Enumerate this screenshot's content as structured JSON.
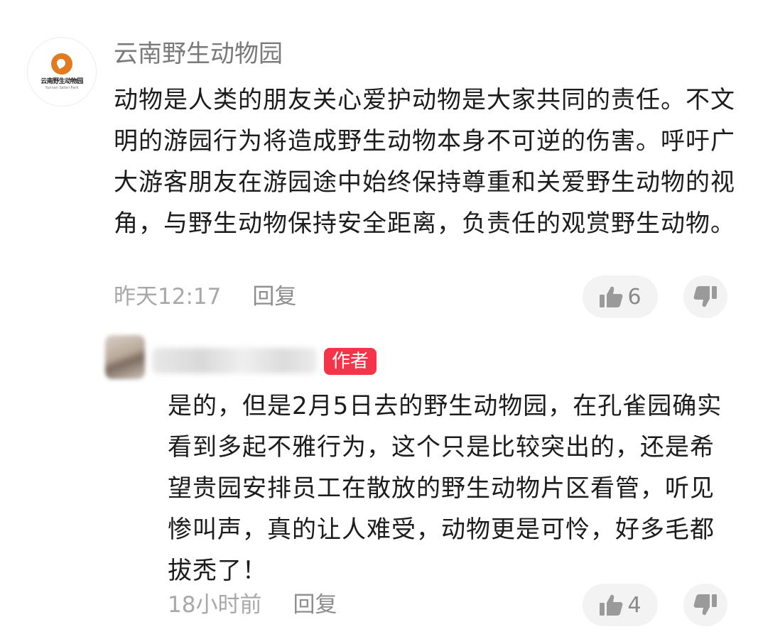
{
  "comment": {
    "username": "云南野生动物园",
    "avatar_logo_text": "云南野生动物园",
    "avatar_logo_subtext": "Yunnan Safari Park",
    "text": "动物是人类的朋友关心爱护动物是大家共同的责任。不文明的游园行为将造成野生动物本身不可逆的伤害。呼吁广大游客朋友在游园途中始终保持尊重和关爱野生动物的视角，与野生动物保持安全距离，负责任的观赏野生动物。",
    "time": "昨天12:17",
    "reply_label": "回复",
    "like_count": "6"
  },
  "reply": {
    "author_badge": "作者",
    "text": "是的，但是2月5日去的野生动物园，在孔雀园确实看到多起不雅行为，这个只是比较突出的，还是希望贵园安排员工在散放的野生动物片区看管，听见惨叫声，真的让人难受，动物更是可怜，好多毛都拔秃了！",
    "time": "18小时前",
    "reply_label": "回复",
    "like_count": "4"
  },
  "colors": {
    "badge": "#f5344a",
    "meta_text": "#a8a8a8",
    "pill_bg": "#f3f3f3",
    "logo_orange": "#e27a1f"
  }
}
